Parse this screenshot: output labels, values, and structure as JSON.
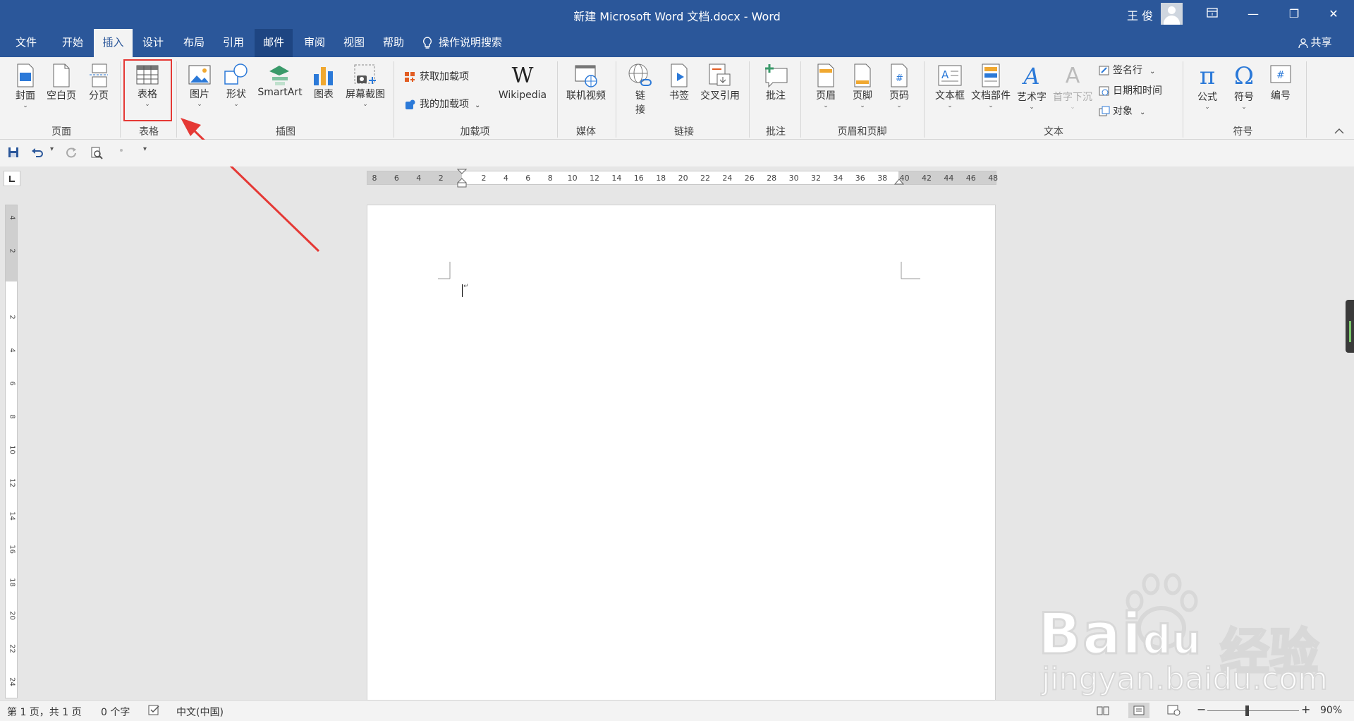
{
  "window": {
    "title": "新建 Microsoft Word 文档.docx  -  Word",
    "user": "王 俊",
    "ribbon_display_icon": "ribbon-display-icon",
    "minimize_glyph": "—",
    "restore_glyph": "❐",
    "close_glyph": "✕"
  },
  "menu": {
    "tabs": [
      "文件",
      "开始",
      "插入",
      "设计",
      "布局",
      "引用",
      "邮件",
      "审阅",
      "视图",
      "帮助"
    ],
    "active_tab": "插入",
    "search_label": "操作说明搜索",
    "share_label": "共享"
  },
  "ribbon": {
    "groups": {
      "page": "页面",
      "table": "表格",
      "illustrations": "插图",
      "addins": "加载项",
      "media": "媒体",
      "links": "链接",
      "comments": "批注",
      "header_footer": "页眉和页脚",
      "text": "文本",
      "symbols": "符号"
    },
    "buttons": {
      "cover": "封面",
      "blank_page": "空白页",
      "page_break": "分页",
      "table": "表格",
      "picture": "图片",
      "shapes": "形状",
      "smartart": "SmartArt",
      "chart": "图表",
      "screenshot": "屏幕截图",
      "get_addins": "获取加载项",
      "my_addins": "我的加载项",
      "wikipedia": "Wikipedia",
      "wikipedia_glyph": "W",
      "online_video": "联机视频",
      "link_1": "链",
      "link_2": "接",
      "bookmark": "书签",
      "cross_reference": "交叉引用",
      "comment": "批注",
      "header": "页眉",
      "footer": "页脚",
      "page_number": "页码",
      "text_box": "文本框",
      "quick_parts": "文档部件",
      "wordart": "艺术字",
      "drop_cap": "首字下沉",
      "signature_line": "签名行",
      "date_time": "日期和时间",
      "object": "对象",
      "equation": "公式",
      "symbol": "符号",
      "numbering": "编号",
      "equation_glyph": "π",
      "symbol_glyph": "Ω",
      "wordart_glyph": "A",
      "dropcap_glyph": "A",
      "page_number_glyph": "#",
      "numbering_glyph": "#"
    }
  },
  "qat": {
    "customize_glyph": "▾"
  },
  "ruler": {
    "left_numbers": [
      "8",
      "6",
      "4",
      "2"
    ],
    "right_numbers": [
      "2",
      "4",
      "6",
      "8",
      "10",
      "12",
      "14",
      "16",
      "18",
      "20",
      "22",
      "24",
      "26",
      "28",
      "30",
      "32",
      "34",
      "36",
      "38",
      "40",
      "42",
      "44",
      "46",
      "48"
    ],
    "vertical_numbers": [
      "4",
      "2",
      "",
      "2",
      "4",
      "6",
      "8",
      "10",
      "12",
      "14",
      "16",
      "18",
      "20",
      "22",
      "24"
    ]
  },
  "document": {
    "cursor_mark": "↵"
  },
  "status": {
    "page": "第 1 页，共 1 页",
    "words": "0 个字",
    "language": "中文(中国)",
    "zoom": "90%",
    "zoom_minus": "−",
    "zoom_plus": "+"
  },
  "watermark": {
    "brand": "Bai",
    "brand_tail": "du",
    "site": "jingyan.baidu.com",
    "cn": "经验"
  },
  "colors": {
    "accent": "#2b579a",
    "highlight": "#e53935"
  }
}
